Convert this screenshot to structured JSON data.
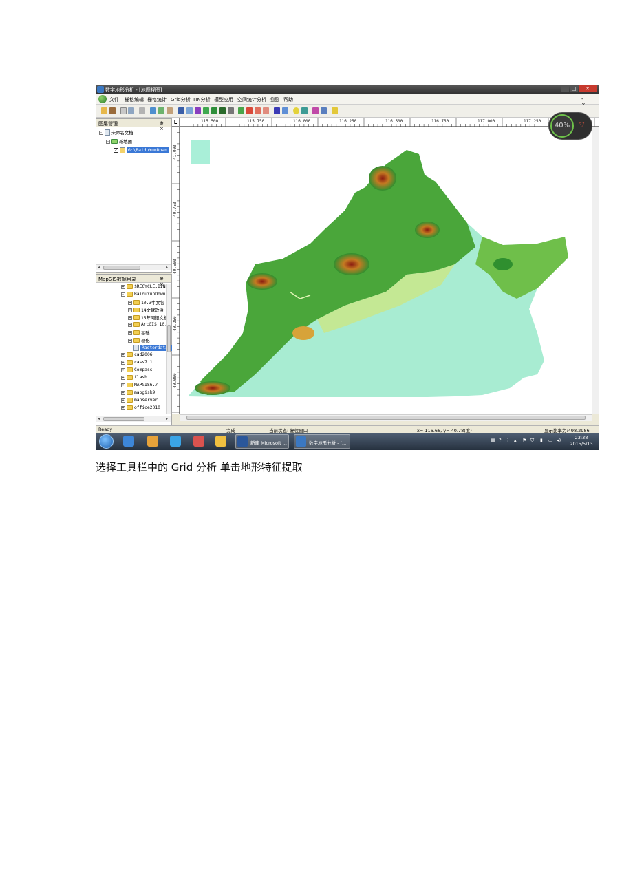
{
  "window": {
    "title": "数字地形分析 - [地图视图]",
    "menu": [
      "文件",
      "栅格编辑",
      "栅格统计",
      "Grid分析",
      "TIN分析",
      "模型应用",
      "空间统计分析",
      "视图",
      "帮助"
    ],
    "min_symbol": "—",
    "max_symbol": "□",
    "close_symbol": "✕",
    "mdi_controls": "- ▫ ×"
  },
  "layer_panel": {
    "title": "图层管理",
    "controls": "⊕ ×",
    "items": [
      {
        "label": "未命名文档"
      },
      {
        "label": "新地图"
      },
      {
        "label": "G:\\BaiduYunDown"
      }
    ]
  },
  "catalog_panel": {
    "title": "MapGIS数据目录",
    "controls": "⊕ ×",
    "items": [
      {
        "label": "$RECYCLE.BIN"
      },
      {
        "label": "BaiduYunDownlo"
      },
      {
        "label": "10.3中文包"
      },
      {
        "label": "14文献政治"
      },
      {
        "label": "15年网銀文档"
      },
      {
        "label": "ArcGIS 10.3"
      },
      {
        "label": "基础"
      },
      {
        "label": "理化"
      },
      {
        "label": "Rasterdatal"
      },
      {
        "label": "cad2006"
      },
      {
        "label": "cass7.1"
      },
      {
        "label": "Compass"
      },
      {
        "label": "flash"
      },
      {
        "label": "MAPGIS6.7"
      },
      {
        "label": "mapgisk9"
      },
      {
        "label": "mapserver"
      },
      {
        "label": "office2010"
      }
    ]
  },
  "map": {
    "corner_label": "L",
    "top_ruler": [
      "115.500",
      "115.750",
      "116.000",
      "116.250",
      "116.500",
      "116.750",
      "117.000",
      "117.250"
    ],
    "left_ruler": [
      "41.000",
      "40.750",
      "40.500",
      "40.250",
      "40.000"
    ]
  },
  "status": {
    "ready": "Ready",
    "done": "完成",
    "state": "当前状态: 复位窗口",
    "coords": "x= 116.66, y= 40.78(度)",
    "scale": "显示比率为:498.2986"
  },
  "taskbar": {
    "word_task": "新建 Microsoft ...",
    "app_task": "数字地形分析 - [...",
    "time": "23:38",
    "date": "2015/5/13"
  },
  "overlay": {
    "percent": "40%",
    "wifi_symbol": "⌔"
  },
  "caption": "选择工具栏中的 Grid 分析    单击地形特征提取"
}
